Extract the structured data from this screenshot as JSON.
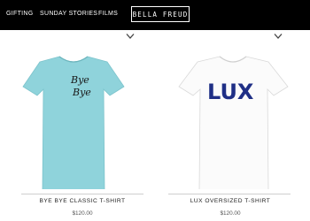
{
  "nav": {
    "items": [
      {
        "label": "GIFTING"
      },
      {
        "label": "SUNDAY STORIES"
      },
      {
        "label": "FILMS"
      }
    ],
    "logo": "BELLA FREUD"
  },
  "products": [
    {
      "name": "BYE BYE CLASSIC T-SHIRT",
      "price": "$120.00",
      "print_text": "Bye Bye",
      "shirt_color": "#8fd3db"
    },
    {
      "name": "LUX OVERSIZED T-SHIRT",
      "price": "$120.00",
      "print_text": "LUX",
      "shirt_color": "#fbfbfb"
    }
  ],
  "colors": {
    "header_bg": "#000000",
    "lux_print": "#1f2f86"
  }
}
